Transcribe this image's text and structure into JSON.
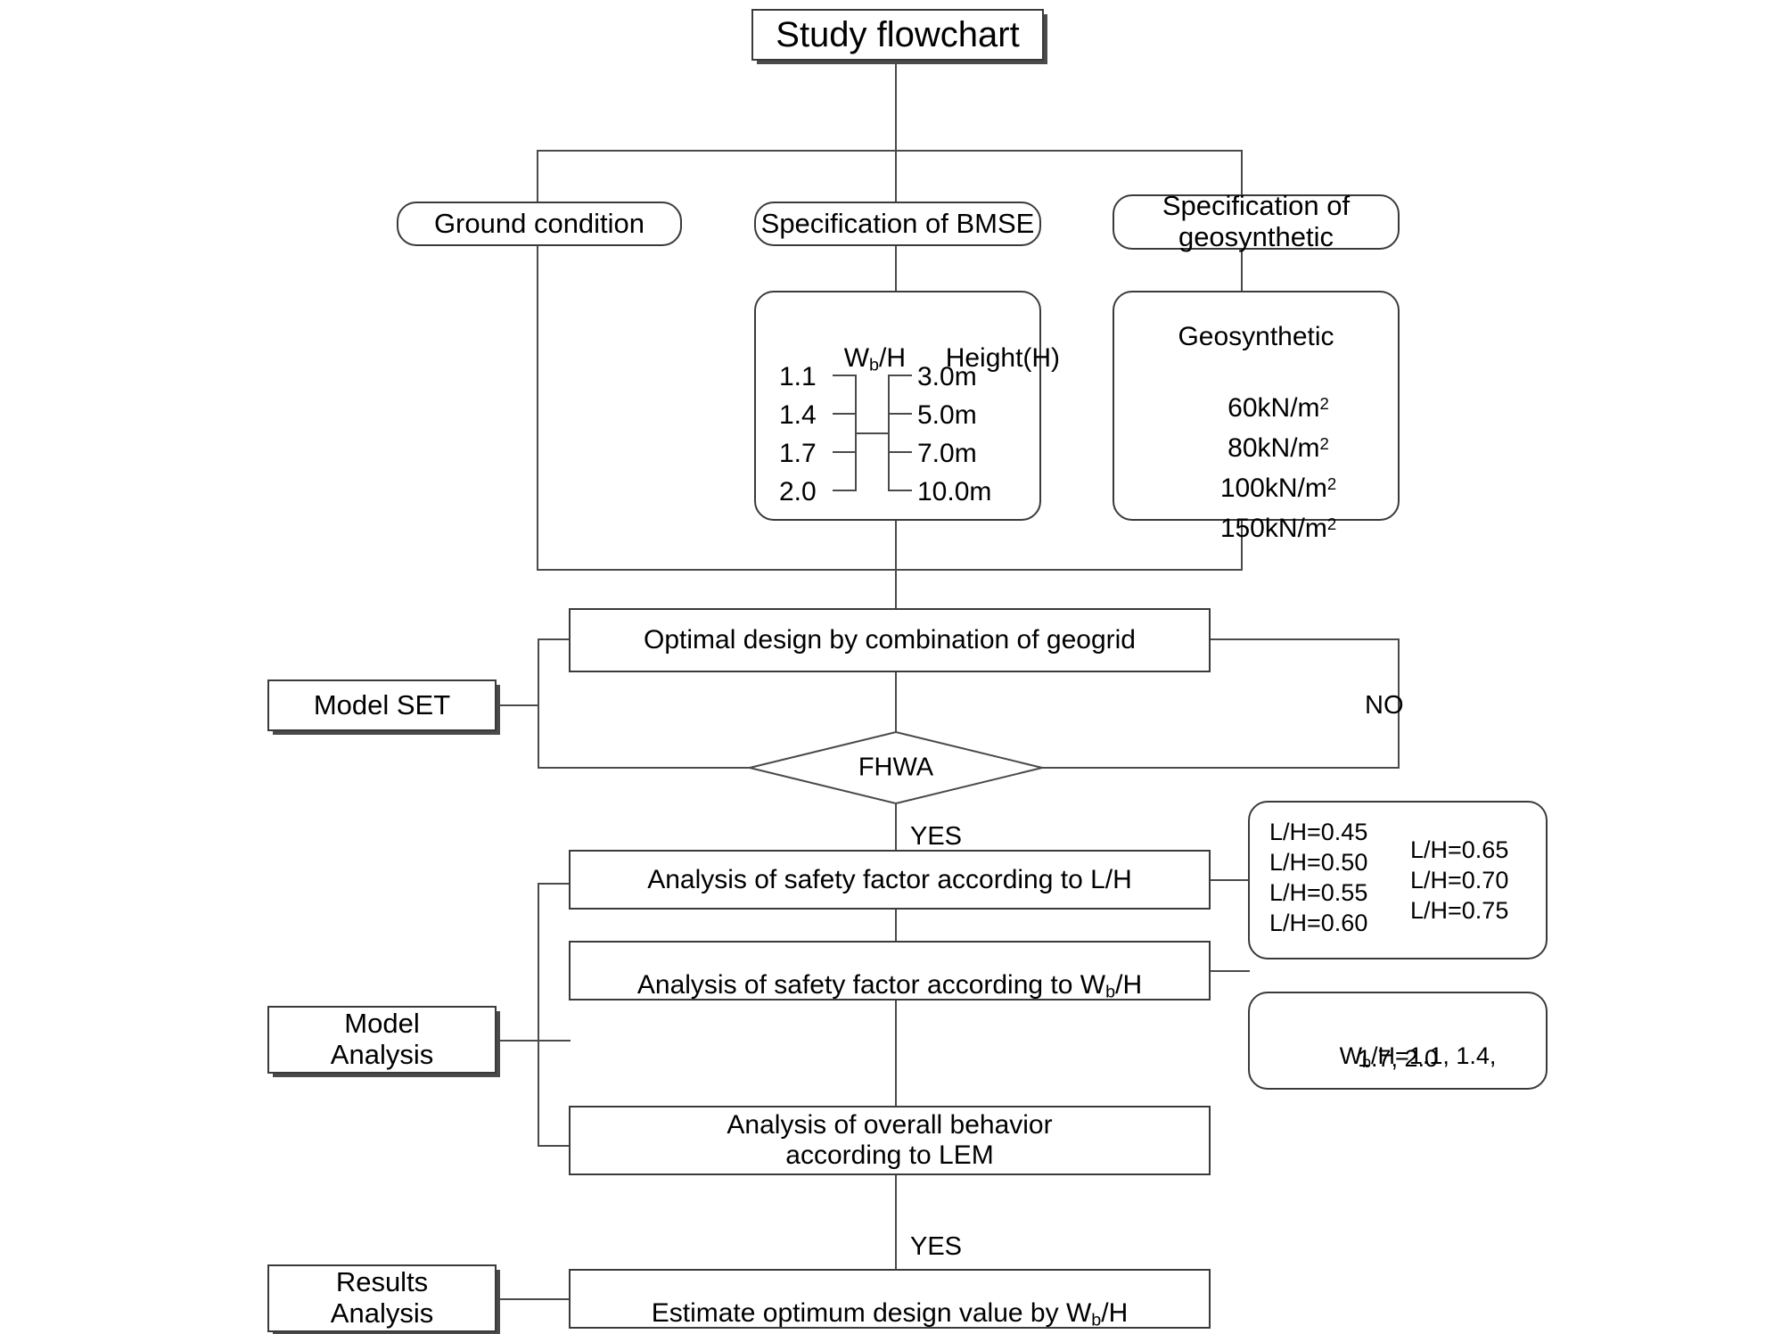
{
  "title": {
    "text": "Study flowchart"
  },
  "stage1": {
    "ground_condition": "Ground condition",
    "spec_bmse": "Specification of BMSE",
    "spec_geosynthetic": "Specification of\ngeosynthetic"
  },
  "bmse_table": {
    "header_left": "W",
    "header_left_sub": "b",
    "header_left_rest": "/H",
    "header_right": "Height(H)",
    "ratios": [
      "1.1",
      "1.4",
      "1.7",
      "2.0"
    ],
    "heights": [
      "3.0m",
      "5.0m",
      "7.0m",
      "10.0m"
    ]
  },
  "geosynthetic_box": {
    "heading": "Geosynthetic",
    "values": [
      "60kN/m",
      "80kN/m",
      "100kN/m",
      "150kN/m"
    ],
    "unit_exponent": "2"
  },
  "model_set": {
    "side_label": "Model SET",
    "optimal_design": "Optimal design by combination of geogrid",
    "decision": "FHWA",
    "decision_no": "NO",
    "decision_yes": "YES"
  },
  "model_analysis": {
    "side_label": "Model\nAnalysis",
    "step_lh_prefix": "Analysis of safety factor according to L/H",
    "step_wbh_pre": "Analysis of safety factor according to W",
    "step_wbh_sub": "b",
    "step_wbh_post": "/H",
    "step_lem": "Analysis of overall behavior\naccording to LEM"
  },
  "lh_values": {
    "left_column": [
      "L/H=0.45",
      "L/H=0.50",
      "L/H=0.55",
      "L/H=0.60"
    ],
    "right_column": [
      "L/H=0.65",
      "L/H=0.70",
      "L/H=0.75"
    ]
  },
  "wbh_values": {
    "pre": "W",
    "sub": "b",
    "post": "/H=1.1, 1.4,",
    "line2": "1.7, 2.0"
  },
  "results": {
    "side_label": "Results\nAnalysis",
    "final_pre": "Estimate optimum design value by W",
    "final_sub": "b",
    "final_post": "/H",
    "yes_label": "YES"
  },
  "colors": {
    "stroke": "#3a3a3a",
    "line": "#4a4a4a",
    "background": "#ffffff",
    "text": "#000000"
  }
}
